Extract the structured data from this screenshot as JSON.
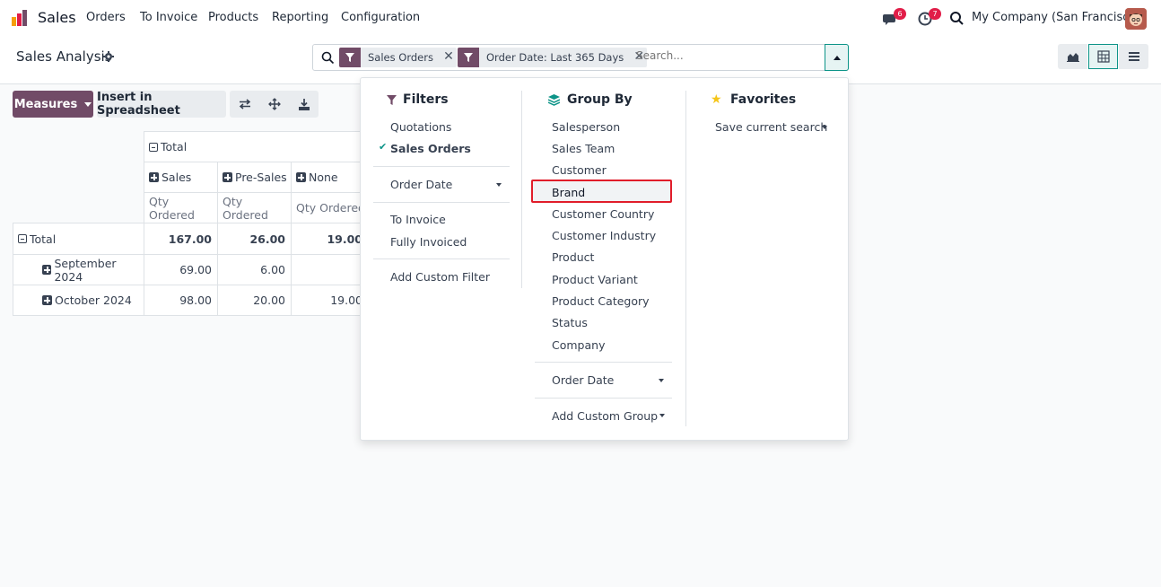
{
  "navbar": {
    "app_name": "Sales",
    "menus": [
      "Orders",
      "To Invoice",
      "Products",
      "Reporting",
      "Configuration"
    ],
    "messages_count": "6",
    "activities_count": "7",
    "company": "My Company (San Francisco)",
    "icons": [
      "app-logo",
      "chat-icon",
      "clock-icon",
      "search-icon",
      "avatar"
    ]
  },
  "control_panel": {
    "title": "Sales Analysis",
    "facets": [
      {
        "label": "Sales Orders"
      },
      {
        "label": "Order Date: Last 365 Days"
      }
    ],
    "search_placeholder": "Search...",
    "views": [
      "graph",
      "pivot",
      "list"
    ],
    "active_view": "pivot"
  },
  "buttons": {
    "measures": "Measures",
    "insert_spreadsheet": "Insert in Spreadsheet"
  },
  "pivot": {
    "col_total": "Total",
    "col_groups": [
      "Sales",
      "Pre-Sales",
      "None"
    ],
    "measure": "Qty Ordered",
    "rows": [
      {
        "label": "Total",
        "values": [
          "167.00",
          "26.00",
          "19.00"
        ]
      },
      {
        "label": "September 2024",
        "values": [
          "69.00",
          "6.00",
          ""
        ]
      },
      {
        "label": "October 2024",
        "values": [
          "98.00",
          "20.00",
          "19.00"
        ]
      }
    ]
  },
  "dropdown": {
    "filters": {
      "title": "Filters",
      "items": [
        "Quotations",
        "Sales Orders"
      ],
      "checked": "Sales Orders",
      "order_date": "Order Date",
      "items2": [
        "To Invoice",
        "Fully Invoiced"
      ],
      "custom": "Add Custom Filter"
    },
    "group_by": {
      "title": "Group By",
      "items": [
        "Salesperson",
        "Sales Team",
        "Customer",
        "Brand",
        "Customer Country",
        "Customer Industry",
        "Product",
        "Product Variant",
        "Product Category",
        "Status",
        "Company"
      ],
      "highlighted": "Brand",
      "order_date": "Order Date",
      "custom": "Add Custom Group"
    },
    "favorites": {
      "title": "Favorites",
      "save": "Save current search"
    }
  },
  "colors": {
    "brand": "#714b67",
    "accent": "#0d9488",
    "highlight": "#e11d2a"
  }
}
